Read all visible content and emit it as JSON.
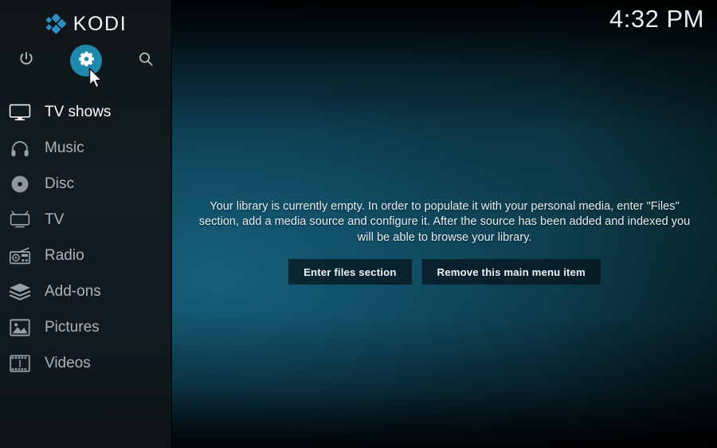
{
  "app": {
    "name": "KODI",
    "logo_icon": "kodi-logo-icon"
  },
  "topbar": {
    "buttons": [
      {
        "name": "power",
        "label": "Power",
        "icon": "power-icon",
        "focused": false
      },
      {
        "name": "settings",
        "label": "Settings",
        "icon": "gear-icon",
        "focused": true
      },
      {
        "name": "search",
        "label": "Search",
        "icon": "search-icon",
        "focused": false
      }
    ],
    "focus_color": "#1f89ac"
  },
  "sidebar": {
    "items": [
      {
        "label": "TV shows",
        "icon": "tv-monitor-icon",
        "focused": true
      },
      {
        "label": "Music",
        "icon": "headphones-icon",
        "focused": false
      },
      {
        "label": "Disc",
        "icon": "disc-icon",
        "focused": false
      },
      {
        "label": "TV",
        "icon": "crt-tv-icon",
        "focused": false
      },
      {
        "label": "Radio",
        "icon": "radio-icon",
        "focused": false
      },
      {
        "label": "Add-ons",
        "icon": "addon-box-icon",
        "focused": false
      },
      {
        "label": "Pictures",
        "icon": "picture-icon",
        "focused": false
      },
      {
        "label": "Videos",
        "icon": "filmstrip-icon",
        "focused": false
      }
    ]
  },
  "main": {
    "clock": "4:32 PM",
    "empty_message": "Your library is currently empty. In order to populate it with your personal media, enter \"Files\" section, add a media source and configure it. After the source has been added and indexed you will be able to browse your library.",
    "buttons": [
      {
        "label": "Enter files section"
      },
      {
        "label": "Remove this main menu item"
      }
    ]
  },
  "cursor": {
    "icon": "mouse-pointer-icon"
  }
}
